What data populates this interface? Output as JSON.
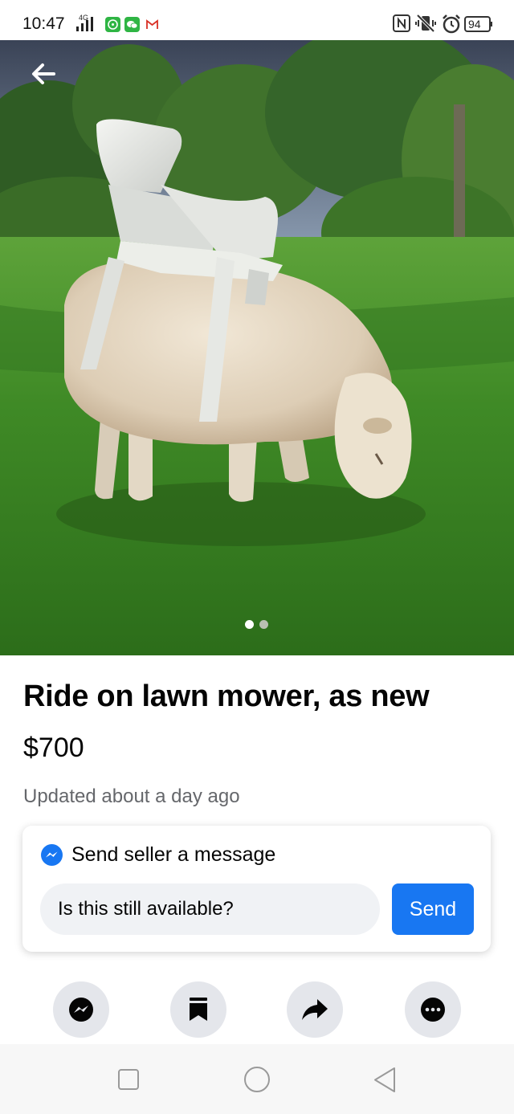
{
  "status_bar": {
    "time": "10:47",
    "network": "4G",
    "battery": "94",
    "icons": [
      "signal-icon",
      "whatsapp-icon",
      "wechat-icon",
      "gmail-icon",
      "nfc-icon",
      "vibrate-icon",
      "alarm-icon",
      "battery-icon"
    ]
  },
  "listing": {
    "title": "Ride on lawn mower, as new",
    "price": "$700",
    "updated": "Updated about a day ago",
    "photo_count": 2,
    "current_photo": 1
  },
  "message_card": {
    "heading": "Send seller a message",
    "input_value": "Is this still available?",
    "send_label": "Send"
  },
  "actions": [
    "messenger-icon",
    "save-bookmark-icon",
    "share-icon",
    "more-icon"
  ],
  "colors": {
    "accent": "#1877f2",
    "text_primary": "#050505",
    "text_secondary": "#65676b",
    "action_bg": "#e4e6eb",
    "input_bg": "#f0f2f5"
  }
}
